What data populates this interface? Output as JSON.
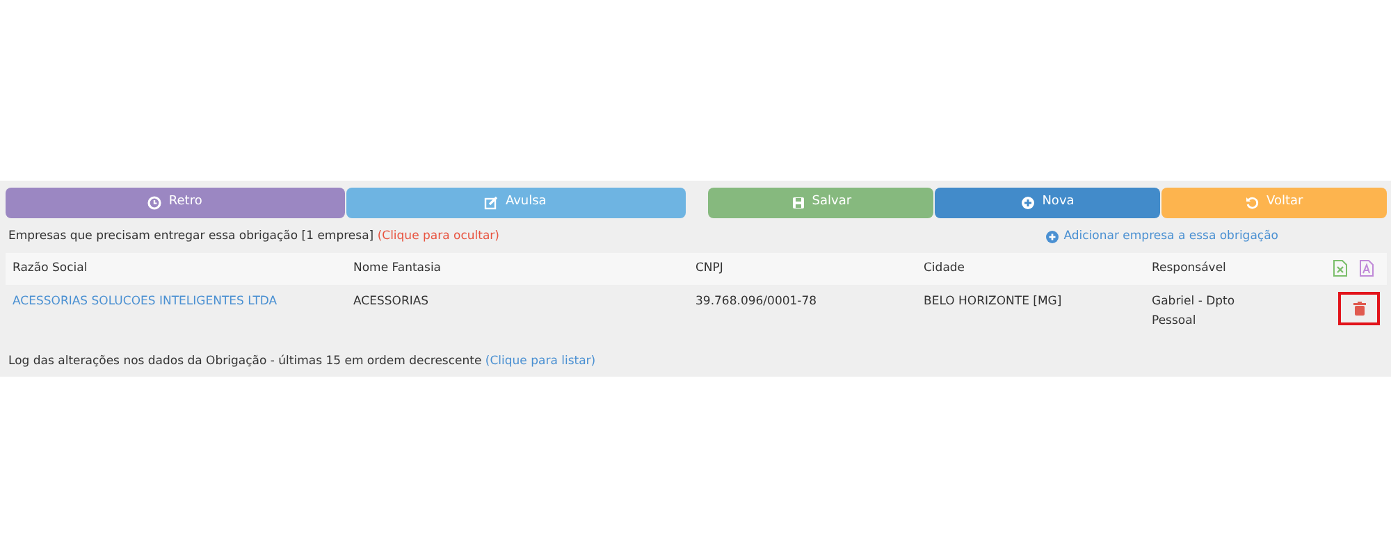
{
  "button_groups": [
    [
      {
        "label": "Retro",
        "color": "#9b87c2"
      },
      {
        "label": "Avulsa",
        "color": "#6eb4e2"
      }
    ],
    [
      {
        "label": "Salvar",
        "color": "#86b97e"
      },
      {
        "label": "Nova",
        "color": "#428bca"
      },
      {
        "label": "Voltar",
        "color": "#fdb44e"
      }
    ]
  ],
  "companies_section": {
    "title": "Empresas que precisam entregar essa obrigação [1 empresa]",
    "toggle_link": "(Clique para ocultar)",
    "add_link": "Adicionar empresa a essa obrigação"
  },
  "table": {
    "columns": [
      "Razão Social",
      "Nome Fantasia",
      "CNPJ",
      "Cidade",
      "Responsável"
    ],
    "rows": [
      {
        "cells": [
          "ACESSORIAS SOLUCOES INTELIGENTES LTDA",
          "ACESSORIAS",
          "39.768.096/0001-78",
          "BELO HORIZONTE [MG]",
          "Gabriel - Dpto Pessoal"
        ],
        "delete_highlighted": true
      }
    ]
  },
  "log_section": {
    "title": "Log das alterações nos dados da Obrigação - últimas 15 em ordem decrescente",
    "toggle_link": "(Clique para listar)"
  }
}
